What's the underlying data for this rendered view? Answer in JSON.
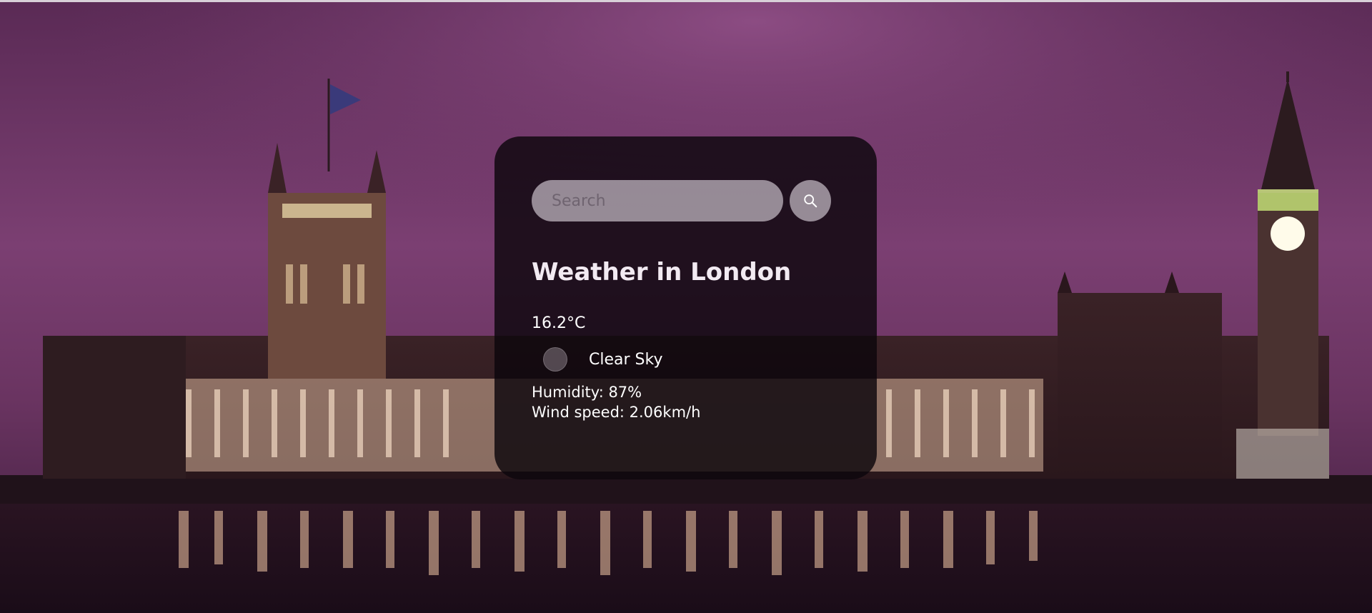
{
  "search": {
    "placeholder": "Search"
  },
  "weather": {
    "city_title": "Weather in London",
    "temperature": "16.2°C",
    "description": "Clear Sky",
    "humidity": "Humidity: 87%",
    "wind": "Wind speed: 2.06km/h"
  },
  "icons": {
    "search_button": "search-icon",
    "weather_condition": "weather-condition-icon"
  },
  "colors": {
    "card_bg": "#0c060c",
    "sky": "#7a3f73",
    "accent_light": "#e1d7e1"
  }
}
